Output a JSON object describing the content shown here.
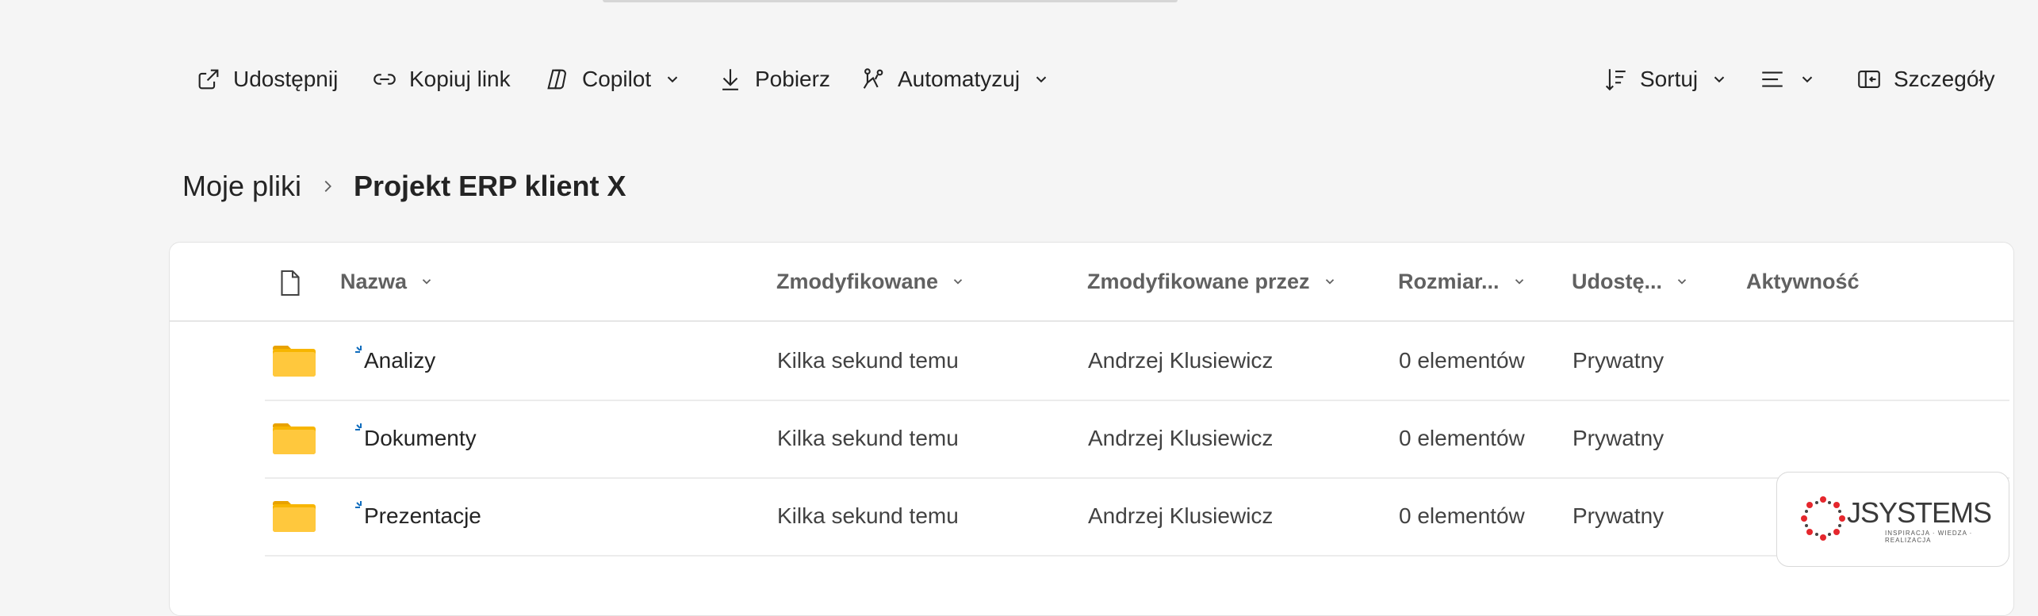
{
  "toolbar": {
    "share_label": "Udostępnij",
    "copy_link_label": "Kopiuj link",
    "copilot_label": "Copilot",
    "download_label": "Pobierz",
    "automate_label": "Automatyzuj",
    "sort_label": "Sortuj",
    "details_label": "Szczegóły"
  },
  "breadcrumb": {
    "root": "Moje pliki",
    "current": "Projekt ERP klient X"
  },
  "table": {
    "columns": {
      "name": "Nazwa",
      "modified": "Zmodyfikowane",
      "modified_by": "Zmodyfikowane przez",
      "size": "Rozmiar...",
      "sharing": "Udostę...",
      "activity": "Aktywność"
    },
    "rows": [
      {
        "name": "Analizy",
        "modified": "Kilka sekund temu",
        "modified_by": "Andrzej Klusiewicz",
        "size": "0 elementów",
        "sharing": "Prywatny"
      },
      {
        "name": "Dokumenty",
        "modified": "Kilka sekund temu",
        "modified_by": "Andrzej Klusiewicz",
        "size": "0 elementów",
        "sharing": "Prywatny"
      },
      {
        "name": "Prezentacje",
        "modified": "Kilka sekund temu",
        "modified_by": "Andrzej Klusiewicz",
        "size": "0 elementów",
        "sharing": "Prywatny"
      }
    ]
  },
  "watermark": {
    "logo_text": "JSYSTEMS",
    "tagline": "INSPIRACJA · WIEDZA · REALIZACJA"
  },
  "icons": {
    "share": "share-icon",
    "link": "link-icon",
    "copilot": "copilot-icon",
    "download": "download-icon",
    "automate": "automate-icon",
    "sort": "sort-icon",
    "view": "view-options-icon",
    "details": "details-pane-icon",
    "folder": "folder-icon",
    "file": "file-icon"
  },
  "colors": {
    "folder": "#f7b500",
    "new_indicator": "#0f6cbd",
    "logo_red": "#e5272d"
  }
}
